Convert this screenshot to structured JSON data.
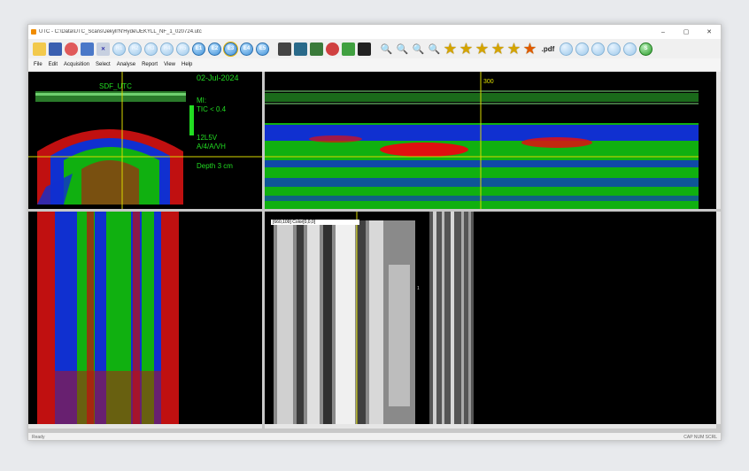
{
  "window": {
    "title": "UTC - C:\\Data\\UTC_Scans\\Jekyll'N'Hyde\\JEKYLL_NF_1_020724.utc",
    "controls": [
      "–",
      "▢",
      "✕"
    ]
  },
  "toolbar": {
    "buttons": [
      {
        "name": "open-icon",
        "label": ""
      },
      {
        "name": "save-icon",
        "label": ""
      },
      {
        "name": "record-icon",
        "label": ""
      },
      {
        "name": "window-icon",
        "label": ""
      },
      {
        "name": "cross-icon",
        "label": ""
      },
      {
        "name": "h1",
        "label": "H1"
      },
      {
        "name": "h2",
        "label": "H2"
      },
      {
        "name": "h3",
        "label": "H3"
      },
      {
        "name": "h4",
        "label": "H4"
      },
      {
        "name": "h5",
        "label": "H5"
      },
      {
        "name": "e1",
        "label": "E1"
      },
      {
        "name": "e2",
        "label": "E2"
      },
      {
        "name": "e3",
        "label": "E3"
      },
      {
        "name": "e4",
        "label": "E4"
      },
      {
        "name": "e5",
        "label": "E5"
      }
    ],
    "pdf_label": ".pdf",
    "s_label": "S"
  },
  "menu": [
    "File",
    "Edit",
    "Acquisition",
    "Select",
    "Analyse",
    "Report",
    "View",
    "Help"
  ],
  "bmode": {
    "date": "02-Jul-2024",
    "preset": "SDF_UTC",
    "mi": "MI:",
    "tic": "TIC < 0.4",
    "probe": "12L5V",
    "mode": "A/4/A/VH",
    "depth": "Depth 3 cm"
  },
  "longitudinal": {
    "marker": "300"
  },
  "raw_view": {
    "cursor_readout": "[660,109] Color[0,0,0]",
    "tick_label": "1"
  },
  "status": {
    "left": "Ready",
    "right": "CAP NUM SCRL"
  },
  "colors": {
    "overlay_green": "#22dd22",
    "crosshair": "#d8d800",
    "tissue_red": "#e01010",
    "tissue_blue": "#1030e0",
    "tissue_green": "#10c010"
  }
}
